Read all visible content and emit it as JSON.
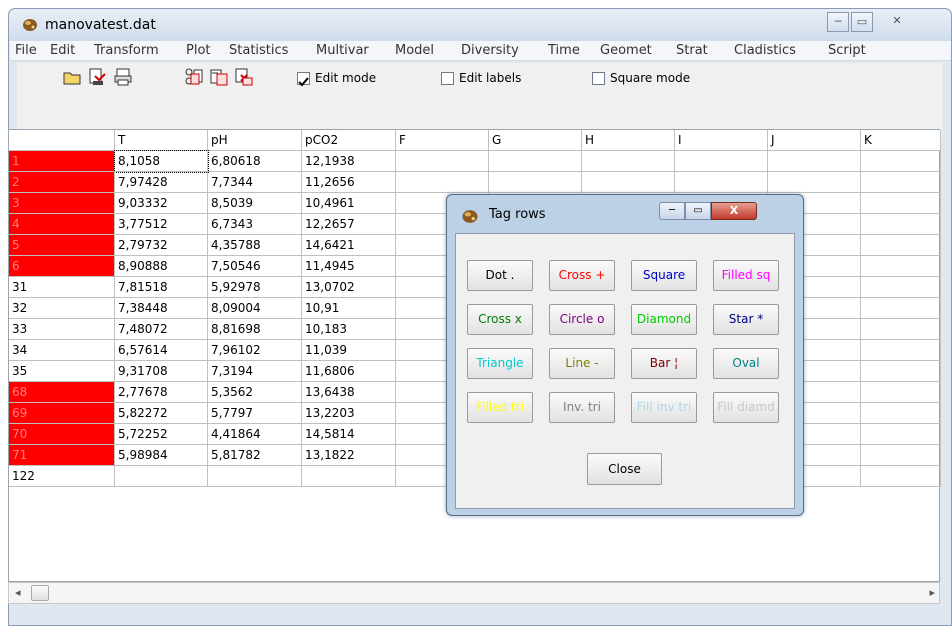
{
  "window": {
    "title": "manovatest.dat",
    "controls": [
      "─",
      "▭",
      "✕"
    ]
  },
  "menu": [
    "File",
    "Edit",
    "Transform",
    "Plot",
    "Statistics",
    "Multivar",
    "Model",
    "Diversity",
    "Time",
    "Geomet",
    "Strat",
    "Cladistics",
    "Script"
  ],
  "toolbar": {
    "icons": [
      "open-file-icon",
      "save-file-icon",
      "print-icon",
      "copy-icon",
      "paste-icon",
      "cut-icon"
    ],
    "checkboxes": [
      {
        "label": "Edit mode",
        "checked": true
      },
      {
        "label": "Edit labels",
        "checked": false
      },
      {
        "label": "Square mode",
        "checked": false
      }
    ]
  },
  "grid": {
    "columns": [
      "",
      "T",
      "pH",
      "pCO2",
      "F",
      "G",
      "H",
      "I",
      "J",
      "K"
    ],
    "rows": [
      {
        "label": "1",
        "tagged": true,
        "cells": [
          "8,1058",
          "6,80618",
          "12,1938"
        ]
      },
      {
        "label": "2",
        "tagged": true,
        "cells": [
          "7,97428",
          "7,7344",
          "11,2656"
        ]
      },
      {
        "label": "3",
        "tagged": true,
        "cells": [
          "9,03332",
          "8,5039",
          "10,4961"
        ]
      },
      {
        "label": "4",
        "tagged": true,
        "cells": [
          "3,77512",
          "6,7343",
          "12,2657"
        ]
      },
      {
        "label": "5",
        "tagged": true,
        "cells": [
          "2,79732",
          "4,35788",
          "14,6421"
        ]
      },
      {
        "label": "6",
        "tagged": true,
        "cells": [
          "8,90888",
          "7,50546",
          "11,4945"
        ]
      },
      {
        "label": "31",
        "tagged": false,
        "cells": [
          "7,81518",
          "5,92978",
          "13,0702"
        ]
      },
      {
        "label": "32",
        "tagged": false,
        "cells": [
          "7,38448",
          "8,09004",
          "10,91"
        ]
      },
      {
        "label": "33",
        "tagged": false,
        "cells": [
          "7,48072",
          "8,81698",
          "10,183"
        ]
      },
      {
        "label": "34",
        "tagged": false,
        "cells": [
          "6,57614",
          "7,96102",
          "11,039"
        ]
      },
      {
        "label": "35",
        "tagged": false,
        "cells": [
          "9,31708",
          "7,3194",
          "11,6806"
        ]
      },
      {
        "label": "68",
        "tagged": true,
        "cells": [
          "2,77678",
          "5,3562",
          "13,6438"
        ]
      },
      {
        "label": "69",
        "tagged": true,
        "cells": [
          "5,82272",
          "5,7797",
          "13,2203"
        ]
      },
      {
        "label": "70",
        "tagged": true,
        "cells": [
          "5,72252",
          "4,41864",
          "14,5814"
        ]
      },
      {
        "label": "71",
        "tagged": true,
        "cells": [
          "5,98984",
          "5,81782",
          "13,1822"
        ]
      },
      {
        "label": "122",
        "tagged": false,
        "cells": [
          "",
          "",
          ""
        ]
      }
    ]
  },
  "dialog": {
    "title": "Tag rows",
    "buttons": [
      {
        "label": "Dot .",
        "color": "#000000"
      },
      {
        "label": "Cross +",
        "color": "#ff0000"
      },
      {
        "label": "Square",
        "color": "#0000cc"
      },
      {
        "label": "Filled sq",
        "color": "#ff00ff"
      },
      {
        "label": "Cross x",
        "color": "#008000"
      },
      {
        "label": "Circle o",
        "color": "#800080"
      },
      {
        "label": "Diamond",
        "color": "#00cc00"
      },
      {
        "label": "Star *",
        "color": "#000080"
      },
      {
        "label": "Triangle",
        "color": "#00cccc"
      },
      {
        "label": "Line -",
        "color": "#808000"
      },
      {
        "label": "Bar ¦",
        "color": "#800000"
      },
      {
        "label": "Oval",
        "color": "#008080"
      },
      {
        "label": "Filled tri",
        "color": "#ffff00"
      },
      {
        "label": "Inv. tri",
        "color": "#808080"
      },
      {
        "label": "Fill inv tri",
        "color": "#add8e6"
      },
      {
        "label": "Fill diamd",
        "color": "#c8c8c8"
      }
    ],
    "close_label": "Close",
    "controls": [
      "─",
      "▭",
      "X"
    ]
  },
  "colors": {
    "tag_red": "#ff0000",
    "title_bar": "#cfdcea"
  }
}
